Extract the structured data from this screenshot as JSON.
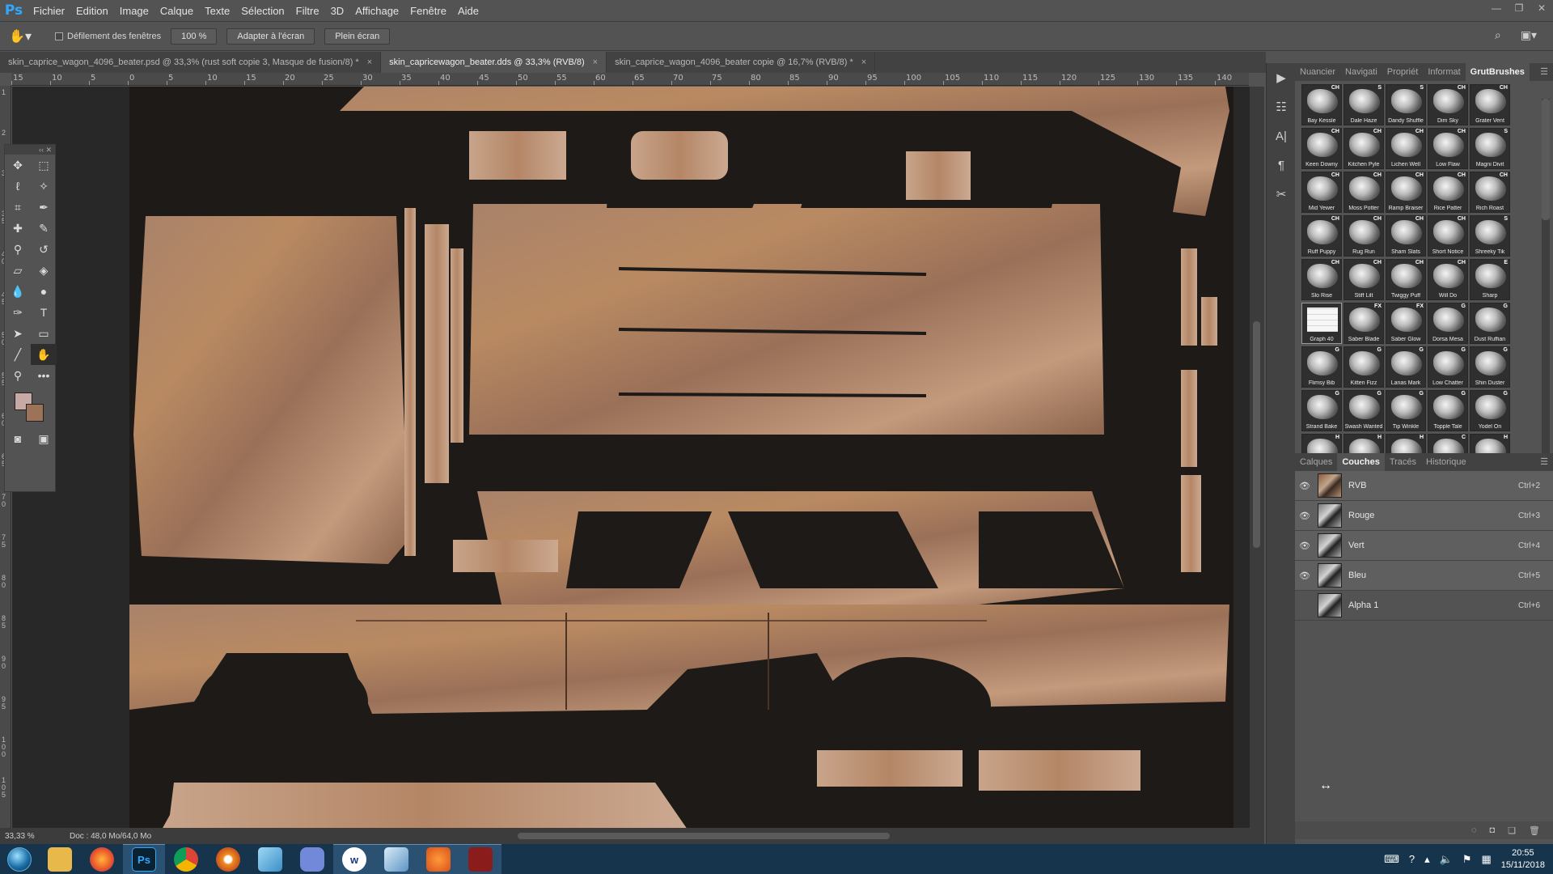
{
  "app": {
    "logo": "Ps"
  },
  "menu": [
    "Fichier",
    "Edition",
    "Image",
    "Calque",
    "Texte",
    "Sélection",
    "Filtre",
    "3D",
    "Affichage",
    "Fenêtre",
    "Aide"
  ],
  "options": {
    "scroll_all_label": "Défilement des fenêtres",
    "zoom_btn": "100 %",
    "fit_btn": "Adapter à l'écran",
    "fill_btn": "Plein écran"
  },
  "tabs": [
    {
      "label": "skin_caprice_wagon_4096_beater.psd @ 33,3% (rust soft copie 3, Masque de fusion/8) *",
      "active": false
    },
    {
      "label": "skin_capricewagon_beater.dds @ 33,3% (RVB/8)",
      "active": true
    },
    {
      "label": "skin_caprice_wagon_4096_beater copie @ 16,7% (RVB/8) *",
      "active": false
    }
  ],
  "ruler_top": [
    "15",
    "10",
    "5",
    "0",
    "5",
    "10",
    "15",
    "20",
    "25",
    "30",
    "35",
    "40",
    "45",
    "50",
    "55",
    "60",
    "65",
    "70",
    "75",
    "80",
    "85",
    "90",
    "95",
    "100",
    "105",
    "110",
    "115",
    "120",
    "125",
    "130",
    "135",
    "140"
  ],
  "ruler_left": [
    "1",
    "2",
    "3",
    "3 5",
    "4 0",
    "4 5",
    "5 0",
    "5 5",
    "6 0",
    "6 5",
    "7 0",
    "7 5",
    "8 0",
    "8 5",
    "9 0",
    "9 5",
    "1 0 0",
    "1 0 5"
  ],
  "status": {
    "zoom": "33,33 %",
    "doc": "Doc : 48,0 Mo/64,0 Mo"
  },
  "right_tabs_top": [
    "Nuancier",
    "Navigati",
    "Propriét",
    "Informat",
    "GrutBrushes"
  ],
  "brushes": [
    {
      "name": "Bay Kessle",
      "tag": "CH"
    },
    {
      "name": "Dale Haze",
      "tag": "S"
    },
    {
      "name": "Dandy Shuffle",
      "tag": "S"
    },
    {
      "name": "Dim Sky",
      "tag": "CH"
    },
    {
      "name": "Grater Vent",
      "tag": "CH"
    },
    {
      "name": "Keen Downy",
      "tag": "CH"
    },
    {
      "name": "Kitchen Pyle",
      "tag": "CH"
    },
    {
      "name": "Lichen Well",
      "tag": "CH"
    },
    {
      "name": "Low Flaw",
      "tag": "CH"
    },
    {
      "name": "Magni Divit",
      "tag": "S"
    },
    {
      "name": "Mid Yewer",
      "tag": "CH"
    },
    {
      "name": "Moss Potter",
      "tag": "CH"
    },
    {
      "name": "Ramp Braiser",
      "tag": "CH"
    },
    {
      "name": "Rice Patter",
      "tag": "CH"
    },
    {
      "name": "Rich Roast",
      "tag": "CH"
    },
    {
      "name": "Ruff Puppy",
      "tag": "CH"
    },
    {
      "name": "Rug Run",
      "tag": "CH"
    },
    {
      "name": "Sham Slats",
      "tag": "CH"
    },
    {
      "name": "Short Notice",
      "tag": "CH"
    },
    {
      "name": "Shreeky Tik",
      "tag": "S"
    },
    {
      "name": "Slo Rise",
      "tag": "CH"
    },
    {
      "name": "Stiff Lilt",
      "tag": "CH"
    },
    {
      "name": "Twiggy Puff",
      "tag": "CH"
    },
    {
      "name": "Will Do",
      "tag": "CH"
    },
    {
      "name": "Sharp",
      "tag": "E"
    },
    {
      "name": "Graph 40",
      "tag": "",
      "selected": true
    },
    {
      "name": "Saber Blade",
      "tag": "FX"
    },
    {
      "name": "Saber Glow",
      "tag": "FX"
    },
    {
      "name": "Dorsa Mesa",
      "tag": "G"
    },
    {
      "name": "Dust Ruffian",
      "tag": "G"
    },
    {
      "name": "Flimsy Bib",
      "tag": "G"
    },
    {
      "name": "Kitten Fizz",
      "tag": "G"
    },
    {
      "name": "Lanas Mark",
      "tag": "G"
    },
    {
      "name": "Low Chatter",
      "tag": "G"
    },
    {
      "name": "Shin Duster",
      "tag": "G"
    },
    {
      "name": "Strand Bake",
      "tag": "G"
    },
    {
      "name": "Swash Wanted",
      "tag": "G"
    },
    {
      "name": "Tip Winkle",
      "tag": "G"
    },
    {
      "name": "Topple Tale",
      "tag": "G"
    },
    {
      "name": "Yodel On",
      "tag": "G"
    },
    {
      "name": "",
      "tag": "H"
    },
    {
      "name": "",
      "tag": "H"
    },
    {
      "name": "",
      "tag": "H"
    },
    {
      "name": "",
      "tag": "C"
    },
    {
      "name": "",
      "tag": "H"
    }
  ],
  "right_tabs_bottom": [
    "Calques",
    "Couches",
    "Tracés",
    "Historique"
  ],
  "channels": [
    {
      "name": "RVB",
      "shortcut": "Ctrl+2",
      "visible": true,
      "color": true
    },
    {
      "name": "Rouge",
      "shortcut": "Ctrl+3",
      "visible": true,
      "color": false
    },
    {
      "name": "Vert",
      "shortcut": "Ctrl+4",
      "visible": true,
      "color": false
    },
    {
      "name": "Bleu",
      "shortcut": "Ctrl+5",
      "visible": true,
      "color": false
    },
    {
      "name": "Alpha 1",
      "shortcut": "Ctrl+6",
      "visible": false,
      "color": false
    }
  ],
  "clock": {
    "time": "20:55",
    "date": "15/11/2018"
  }
}
